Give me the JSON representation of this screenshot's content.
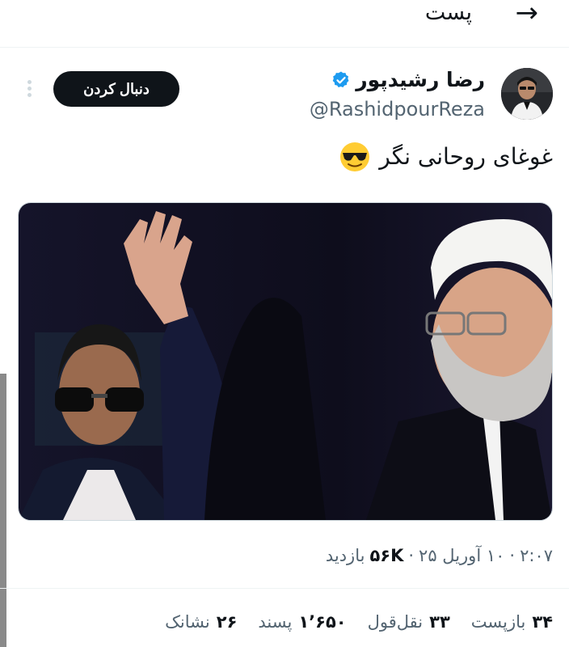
{
  "header": {
    "title": "پست",
    "back_icon": "arrow-right-icon"
  },
  "author": {
    "display_name": "رضا رشیدپور",
    "handle": "@RashidpourReza",
    "verified_icon": "verified-badge-icon",
    "verified_color": "#1d9bf0"
  },
  "follow_button": {
    "label": "دنبال کردن"
  },
  "tweet": {
    "text": "غوغای روحانی نگر",
    "emoji_icon": "smiling-face-with-sunglasses-icon"
  },
  "meta": {
    "time": "۲:۰۷",
    "date": "۱۰ آوریل ۲۵",
    "views_count": "۵۶K",
    "views_label": "بازدید",
    "separator": "·"
  },
  "stats": [
    {
      "count": "۳۴",
      "label": "بازپست"
    },
    {
      "count": "۳۳",
      "label": "نقل‌قول"
    },
    {
      "count": "۱٬۶۵۰",
      "label": "پسند"
    },
    {
      "count": "۲۶",
      "label": "نشانک"
    }
  ],
  "colors": {
    "text": "#0f1419",
    "secondary": "#536471",
    "accent": "#1d9bf0",
    "button_bg": "#0f1419"
  }
}
